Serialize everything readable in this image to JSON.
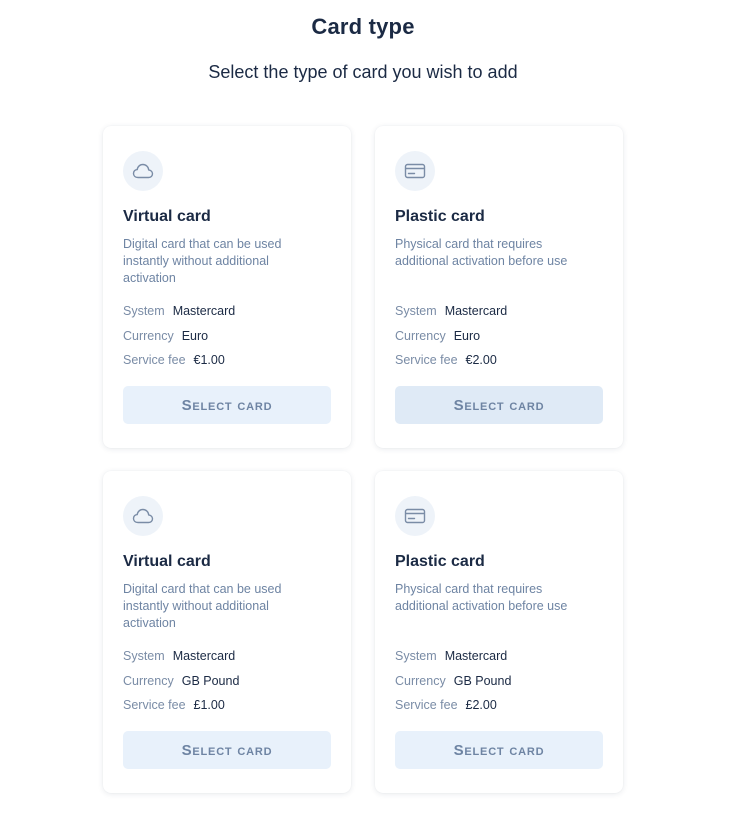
{
  "header": {
    "title": "Card type",
    "subtitle": "Select the type of card you wish to add"
  },
  "labels": {
    "system": "System",
    "currency": "Currency",
    "service_fee": "Service fee"
  },
  "cards": [
    {
      "icon": "cloud-icon",
      "title": "Virtual card",
      "description": "Digital card that can be used instantly without additional activation",
      "system": "Mastercard",
      "currency": "Euro",
      "service_fee": "€1.00",
      "button_label": "Select card"
    },
    {
      "icon": "credit-card-icon",
      "title": "Plastic card",
      "description": "Physical card that requires additional activation before use",
      "system": "Mastercard",
      "currency": "Euro",
      "service_fee": "€2.00",
      "button_label": "Select card"
    },
    {
      "icon": "cloud-icon",
      "title": "Virtual card",
      "description": "Digital card that can be used instantly without additional activation",
      "system": "Mastercard",
      "currency": "GB Pound",
      "service_fee": "£1.00",
      "button_label": "Select card"
    },
    {
      "icon": "credit-card-icon",
      "title": "Plastic card",
      "description": "Physical card that requires additional activation before use",
      "system": "Mastercard",
      "currency": "GB Pound",
      "service_fee": "£2.00",
      "button_label": "Select card"
    }
  ],
  "colors": {
    "text_primary": "#1b2a44",
    "text_secondary": "#6e84a3",
    "button_bg": "#e8f1fb",
    "icon_bg": "#eef3f9"
  }
}
